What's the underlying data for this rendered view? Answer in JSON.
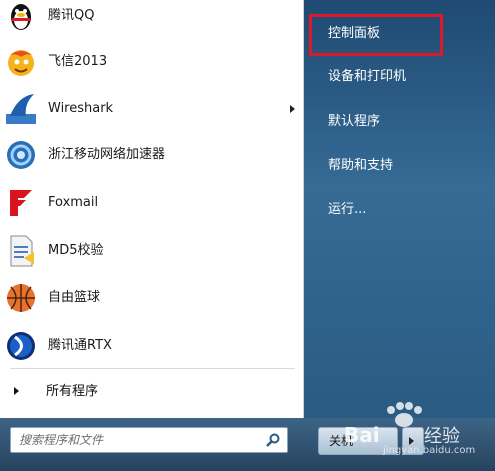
{
  "programs": [
    {
      "label": "腾讯QQ",
      "icon": "qq-penguin-icon"
    },
    {
      "label": "飞信2013",
      "icon": "fetion-icon"
    },
    {
      "label": "Wireshark",
      "icon": "wireshark-fin-icon",
      "has_submenu": true
    },
    {
      "label": "浙江移动网络加速器",
      "icon": "network-accelerator-icon"
    },
    {
      "label": "Foxmail",
      "icon": "foxmail-icon"
    },
    {
      "label": "MD5校验",
      "icon": "md5-document-icon"
    },
    {
      "label": "自由篮球",
      "icon": "basketball-icon"
    },
    {
      "label": "腾讯通RTX",
      "icon": "rtx-icon"
    }
  ],
  "all_programs_label": "所有程序",
  "search": {
    "placeholder": "搜索程序和文件"
  },
  "right_menu": [
    {
      "label": "控制面板",
      "highlighted": true
    },
    {
      "label": "设备和打印机"
    },
    {
      "label": "默认程序"
    },
    {
      "label": "帮助和支持"
    },
    {
      "label": "运行..."
    }
  ],
  "shutdown_label": "关机",
  "watermark": {
    "logo": "Baidu经验",
    "url": "jingyan.baidu.com"
  },
  "colors": {
    "highlight_border": "#e0162b",
    "right_pane": "#2f6390",
    "left_pane": "#ffffff"
  }
}
